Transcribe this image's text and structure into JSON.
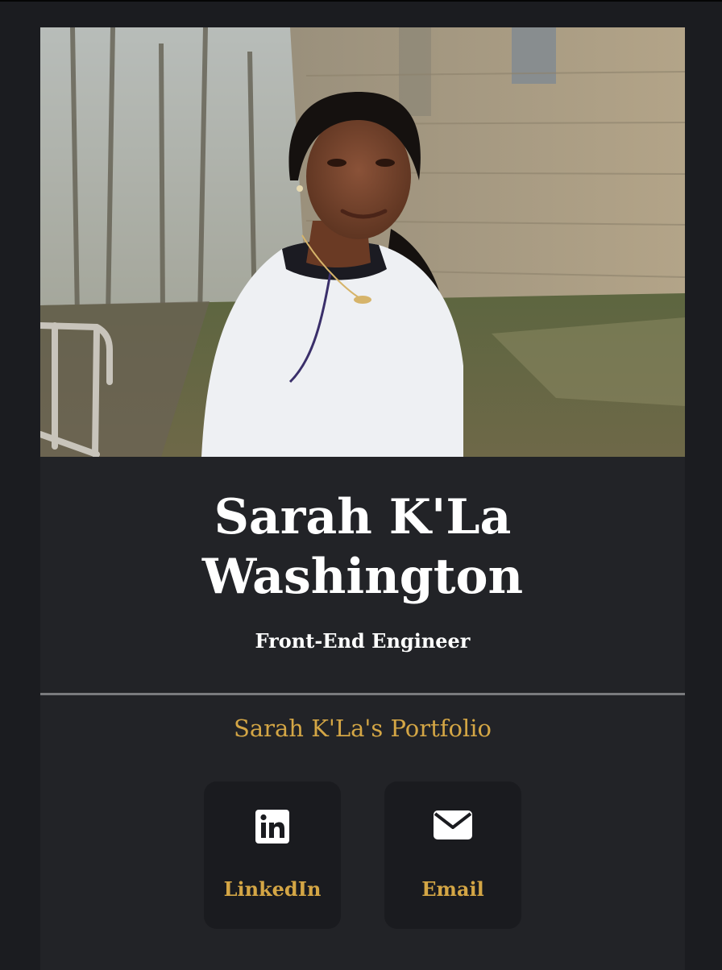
{
  "profile": {
    "name_line1": "Sarah K'La",
    "name_line2": "Washington",
    "role": "Front-End Engineer"
  },
  "portfolio": {
    "title": "Sarah K'La's Portfolio"
  },
  "links": [
    {
      "label": "LinkedIn",
      "icon": "linkedin-icon"
    },
    {
      "label": "Email",
      "icon": "envelope-icon"
    }
  ],
  "colors": {
    "background": "#1b1c20",
    "card": "#222327",
    "tile": "#1a1b1f",
    "accent": "#d4a645",
    "text": "#ffffff",
    "divider": "#7a7b7e"
  }
}
